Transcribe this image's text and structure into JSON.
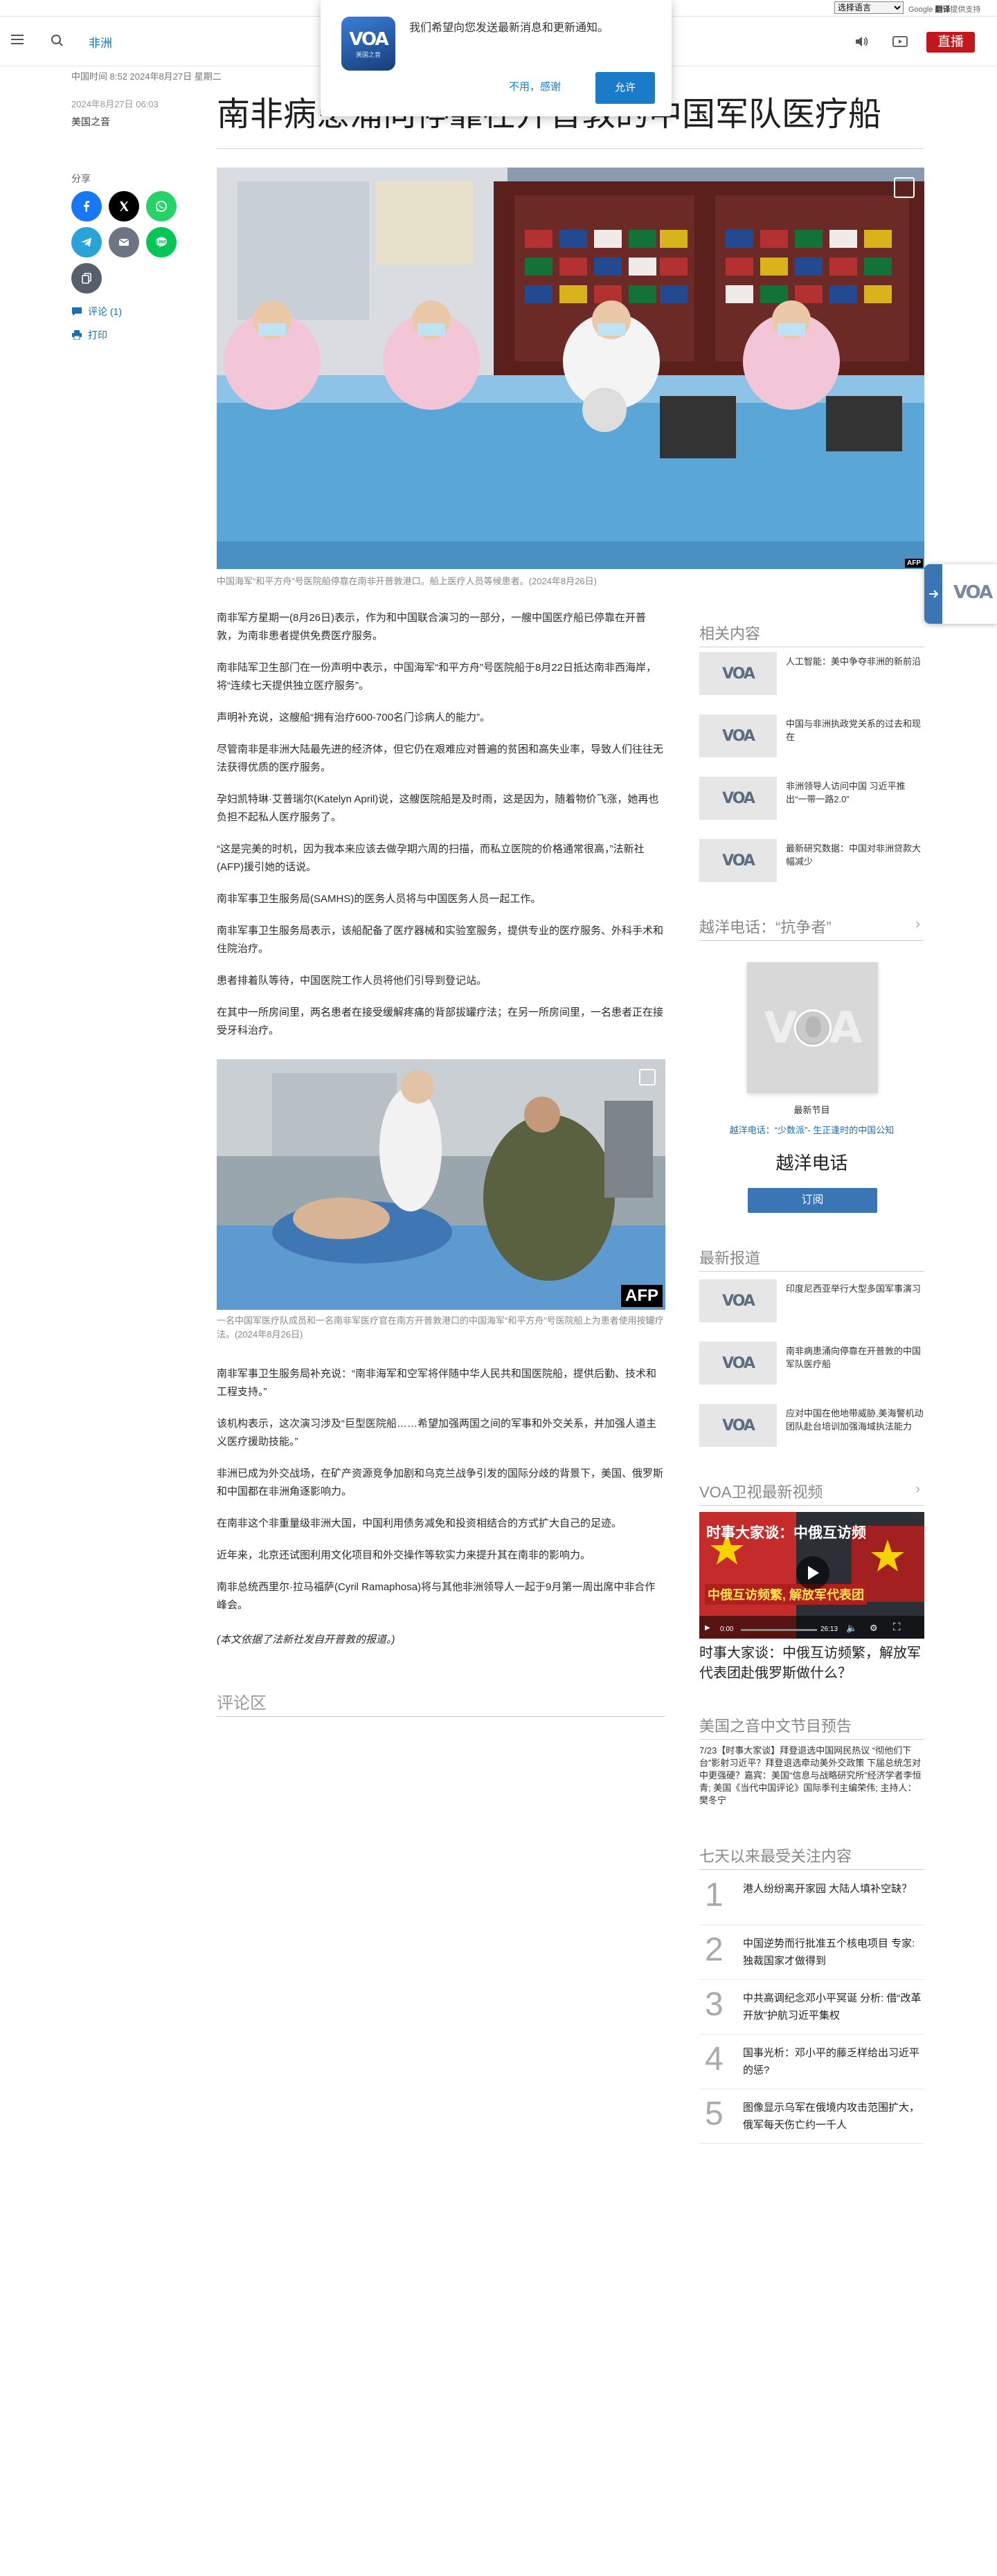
{
  "translate": {
    "select_label": "选择语言",
    "powered": "Google",
    "translate_label": "翻译",
    "powered_suffix": "提供支持"
  },
  "nav": {
    "section": "非洲",
    "live": "直播"
  },
  "notification": {
    "text": "我们希望向您发送最新消息和更新通知。",
    "deny": "不用，感谢",
    "allow": "允许",
    "logo_sub": "美国之音"
  },
  "article": {
    "timeline": "中国时间 8:52 2024年8月27日 星期二",
    "date": "2024年8月27日 06:03",
    "source": "美国之音",
    "title": "南非病患涌向停靠在开普敦的中国军队医疗船",
    "share_label": "分享",
    "comments_link": "评论 (1)",
    "print_link": "打印",
    "hero_caption": "中国海军“和平方舟”号医院船停靠在南非开普敦港口。船上医疗人员等候患者。(2024年8月26日)",
    "hero_credit": "AFP",
    "photo2_caption": "一名中国军医疗队成员和一名南非军医疗官在南方开普敦港口的中国海军“和平方舟”号医院船上为患者使用按罐疗法。(2024年8月26日)",
    "photo2_credit": "AFP",
    "paras_a": [
      "南非军方星期一(8月26日)表示，作为和中国联合演习的一部分，一艘中国医疗船已停靠在开普敦，为南非患者提供免费医疗服务。",
      "南非陆军卫生部门在一份声明中表示，中国海军“和平方舟”号医院船于8月22日抵达南非西海岸，将“连续七天提供独立医疗服务”。",
      "声明补充说，这艘船“拥有治疗600-700名门诊病人的能力”。",
      "尽管南非是非洲大陆最先进的经济体，但它仍在艰难应对普遍的贫困和高失业率，导致人们往往无法获得优质的医疗服务。",
      "孕妇凯特琳·艾普瑞尔(Katelyn April)说，这艘医院船是及时雨，这是因为，随着物价飞涨，她再也负担不起私人医疗服务了。",
      "“这是完美的时机，因为我本来应该去做孕期六周的扫描，而私立医院的价格通常很高，”法新社(AFP)援引她的话说。",
      "南非军事卫生服务局(SAMHS)的医务人员将与中国医务人员一起工作。",
      "南非军事卫生服务局表示，该船配备了医疗器械和实验室服务，提供专业的医疗服务、外科手术和住院治疗。",
      "患者排着队等待，中国医院工作人员将他们引导到登记站。",
      "在其中一所房间里，两名患者在接受缓解疼痛的背部拔罐疗法；在另一所房间里，一名患者正在接受牙科治疗。"
    ],
    "paras_b": [
      "南非军事卫生服务局补充说：“南非海军和空军将伴随中华人民共和国医院船，提供后勤、技术和工程支持。”",
      "该机构表示，这次演习涉及“巨型医院船……希望加强两国之间的军事和外交关系，并加强人道主义医疗援助技能。”",
      "非洲已成为外交战场，在矿产资源竞争加剧和乌克兰战争引发的国际分歧的背景下，美国、俄罗斯和中国都在非洲角逐影响力。",
      "在南非这个非重量级非洲大国，中国利用债务减免和投资相结合的方式扩大自己的足迹。",
      "近年来，北京还试图利用文化项目和外交操作等软实力来提升其在南非的影响力。",
      "南非总统西里尔·拉马福萨(Cyril Ramaphosa)将与其他非洲领导人一起于9月第一周出席中非合作峰会。"
    ],
    "footnote": "(本文依据了法新社发自开普敦的报道。)",
    "comments_heading": "评论区"
  },
  "sidebar": {
    "related_heading": "相关内容",
    "related": [
      "人工智能：美中争夺非洲的新前沿",
      "中国与非洲执政党关系的过去和现在",
      "非洲领导人访问中国 习近平推出“一带一路2.0”",
      "最新研究数据：中国对非洲贷款大幅减少"
    ],
    "podcast_heading": "越洋电话：“抗争者”",
    "latest_episode": "最新节目",
    "episode_link": "越洋电话：“少数派”- 生正逢时的中国公知",
    "podcast_title": "越洋电话",
    "subscribe": "订阅",
    "latest_heading": "最新报道",
    "latest": [
      "印度尼西亚举行大型多国军事演习",
      "南非病患涌向停靠在开普敦的中国军队医疗船",
      "应对中国在他地带威胁,美海警机动团队赴台培训加强海域执法能力"
    ],
    "video_heading": "VOA卫视最新视频",
    "video_overlay": "时事大家谈：中俄互访频...",
    "video_banner": "中俄互访频繁, 解放军代表团",
    "video_time": "0:00",
    "video_duration": "26:13",
    "video_title": "时事大家谈：中俄互访频繁，解放军代表团赴俄罗斯做什么？",
    "schedule_heading": "美国之音中文节目预告",
    "schedule_text": "7/23【时事大家谈】拜登退选中国网民热议 “彻他们下台”影射习近平？拜登退选牵动美外交政策 下届总统怎对中更强硬？嘉宾：美国“信息与战略研究所”经济学者李恒青; 美国《当代中国评论》国际季刊主编荣伟; 主持人：樊冬宁",
    "popular_heading": "七天以来最受关注内容",
    "popular": [
      {
        "n": "1",
        "t": "港人纷纷离开家园 大陆人填补空缺？"
      },
      {
        "n": "2",
        "t": "中国逆势而行批准五个核电项目 专家: 独裁国家才做得到"
      },
      {
        "n": "3",
        "t": "中共高调纪念邓小平冥诞 分析: 借“改革开放”护航习近平集权"
      },
      {
        "n": "4",
        "t": "国事光析：邓小平的藤乏样给出习近平的惩?"
      },
      {
        "n": "5",
        "t": "图像显示乌军在俄境内攻击范围扩大，俄军每天伤亡约一千人"
      }
    ]
  },
  "colors": {
    "live_red": "#c4161c",
    "link_blue": "#1a6fb0",
    "facebook": "#1877f2",
    "x": "#000000",
    "whatsapp": "#25d366",
    "telegram": "#2aa3d9",
    "email": "#6b7682",
    "line": "#06c755",
    "copy": "#55606a"
  }
}
